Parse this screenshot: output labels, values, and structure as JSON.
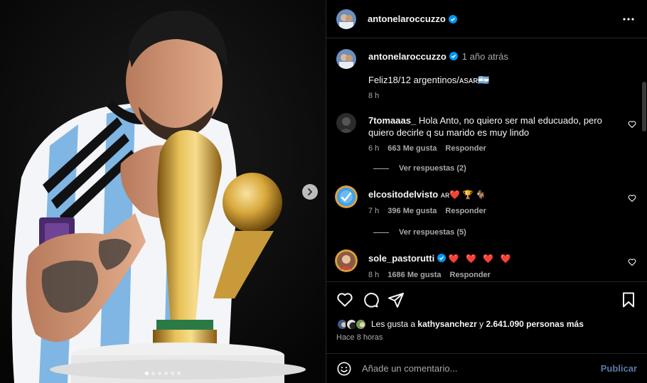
{
  "post": {
    "image_alt": "Photo of a footballer in an Argentina jersey kissing the World Cup trophy",
    "carousel_dots": 6,
    "carousel_active": 0
  },
  "header": {
    "username": "antonelaroccuzzo",
    "more_icon": "ellipsis-icon"
  },
  "caption": {
    "username": "antonelaroccuzzo",
    "time_ago": "1 año atrás",
    "text": "Feliz18/12 argentinos/ᴀsᴀʀ🇦🇷",
    "age": "8 h"
  },
  "comments": [
    {
      "username": "7tomaaas_",
      "text": "Hola Anto, no quiero ser mal educuado, pero quiero decirle q su marido es muy lindo",
      "age": "6 h",
      "likes": "663 Me gusta",
      "reply_label": "Responder",
      "view_replies": "Ver respuestas (2)"
    },
    {
      "username": "elcositodelvisto",
      "text": "ᴀʀ❤️ 🏆 🐐",
      "age": "7 h",
      "likes": "396 Me gusta",
      "reply_label": "Responder",
      "view_replies": "Ver respuestas (5)"
    },
    {
      "username": "sole_pastorutti",
      "text": "❤️ ❤️ ❤️ ❤️",
      "age": "8 h",
      "likes": "1686 Me gusta",
      "reply_label": "Responder"
    }
  ],
  "likes": {
    "prefix": "Les gusta a ",
    "user": "kathysanchezr",
    "middle": " y ",
    "count": "2.641.090 personas más"
  },
  "posted_ago": "Hace 8 horas",
  "composer": {
    "placeholder": "Añade un comentario...",
    "publish_label": "Publicar"
  },
  "colors": {
    "background": "#000000",
    "text": "#f5f5f5",
    "muted": "#a8a8a8",
    "verified": "#0095f6",
    "heart_red": "#ed4956",
    "publish": "#5a79a8"
  }
}
